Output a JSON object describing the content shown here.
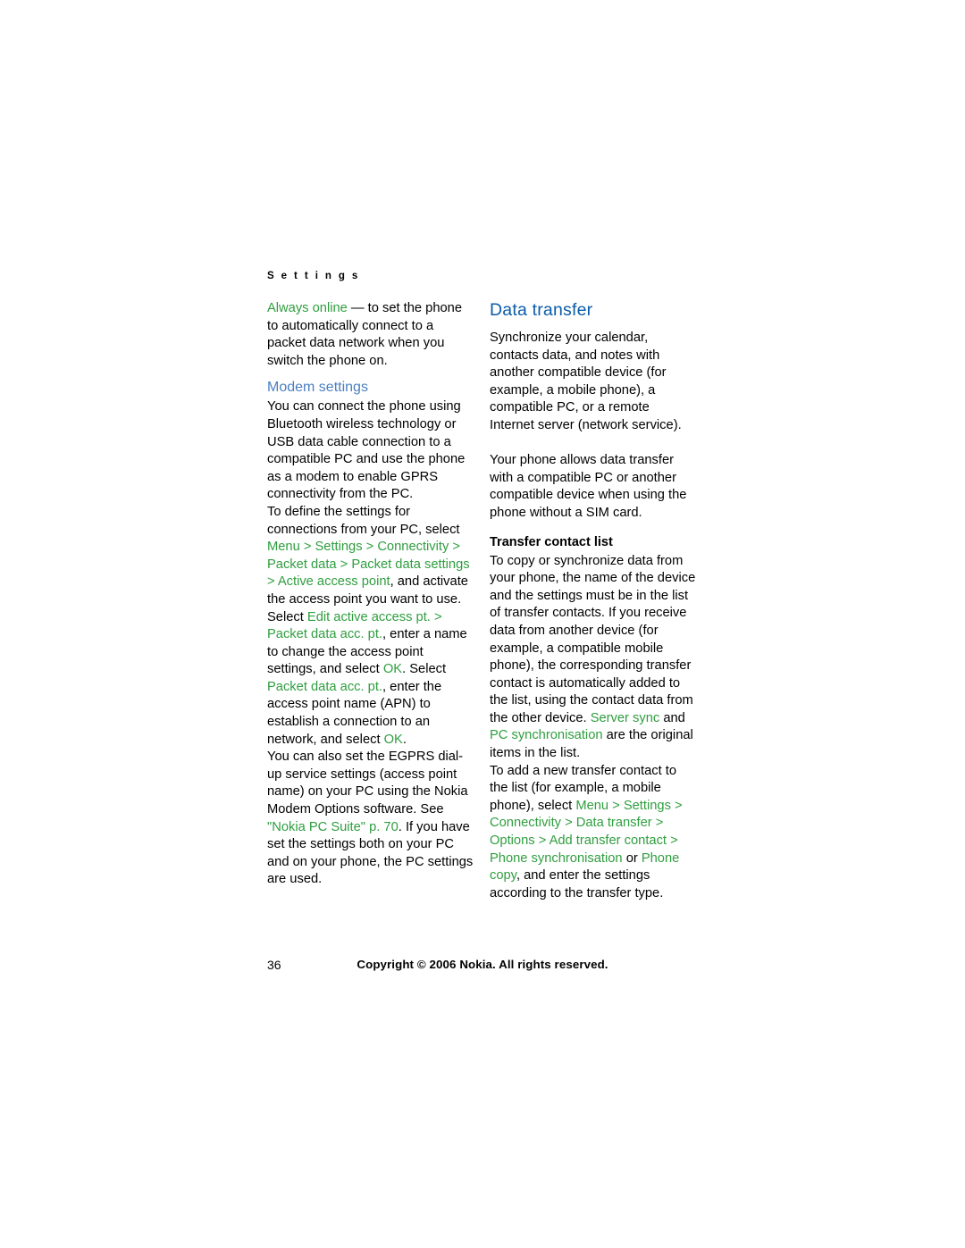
{
  "page": {
    "running_header": "S e t t i n g s",
    "page_number": "36",
    "copyright": "Copyright © 2006 Nokia. All rights reserved."
  },
  "left_column": {
    "p1_a": "Always online",
    "p1_b": " — to set the phone to automatically connect to a packet data network when you switch the phone on.",
    "heading_modem": "Modem settings",
    "p2": "You can connect the phone using Bluetooth wireless technology or USB data cable connection to a compatible PC and use the phone as a modem to enable GPRS connectivity from the PC.",
    "p3_a": "To define the settings for connections from your PC, select ",
    "p3_menu": "Menu",
    "p3_gt1": " > ",
    "p3_settings": "Settings",
    "p3_gt2": " > ",
    "p3_connectivity": "Connectivity",
    "p3_gt3": " > ",
    "p3_packetdata": "Packet data",
    "p3_gt4": " > ",
    "p3_pds": "Packet data settings",
    "p3_gt5": " > ",
    "p3_aap": "Active access point",
    "p3_b": ", and activate the access point you want to use. Select ",
    "p3_edit": "Edit active access pt.",
    "p3_c": " > ",
    "p3_pdacc": "Packet data acc. pt.",
    "p3_d": ", enter a name to change the access point settings, and select ",
    "p3_ok1": "OK",
    "p3_e": ". Select ",
    "p3_pdaccpt": "Packet data acc. pt.",
    "p3_f": ", enter the access point name (APN) to establish a connection to an network, and select ",
    "p3_ok2": "OK",
    "p3_g": ".",
    "p4_a": "You can also set the EGPRS dial-up service settings (access point name) on your PC using the Nokia Modem Options software. See ",
    "p4_link": "\"Nokia PC Suite\" p. 70",
    "p4_b": ". If you have set the settings both on your PC and on your phone, the PC settings are used."
  },
  "right_column": {
    "heading_data_transfer": "Data transfer",
    "p1": "Synchronize your calendar, contacts data, and notes with another compatible device (for example, a mobile phone), a compatible PC, or a remote Internet server (network service).",
    "p2": "Your phone allows data transfer with a compatible PC or another compatible device when using the phone without a SIM card.",
    "heading_transfer_contact_list": "Transfer contact list",
    "p3_a": "To copy or synchronize data from your phone, the name of the device and the settings must be in the list of transfer contacts. If you receive data from another device (for example, a compatible mobile phone), the corresponding transfer contact is automatically added to the list, using the contact data from the other device. ",
    "p3_serversync": "Server sync",
    "p3_b": " and ",
    "p3_pcsync": "PC synchronisation",
    "p3_c": " are the original items in the list.",
    "p4_a": "To add a new transfer contact to the list (for example, a mobile phone), select ",
    "p4_menu": "Menu",
    "p4_gt1": " > ",
    "p4_settings": "Settings",
    "p4_gt2": " > ",
    "p4_connectivity": "Connectivity",
    "p4_gt3": " > ",
    "p4_datatransfer": "Data transfer",
    "p4_gt4": " > ",
    "p4_options": "Options",
    "p4_gt5": " > ",
    "p4_addcontact": "Add transfer contact",
    "p4_gt6": " > ",
    "p4_phonesync": "Phone synchronisation",
    "p4_or": " or ",
    "p4_phonecopy": "Phone copy",
    "p4_b": ", and enter the settings according to the transfer type."
  }
}
